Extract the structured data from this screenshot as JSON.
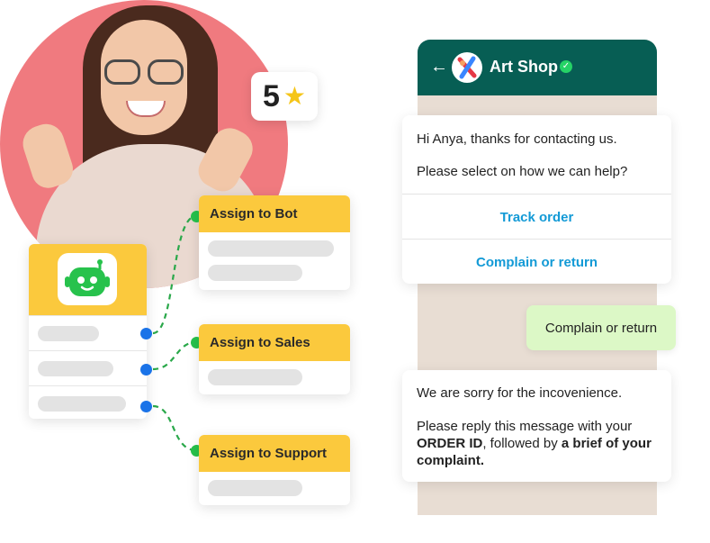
{
  "rating": {
    "value": "5",
    "icon": "star-icon"
  },
  "bot_card": {
    "icon": "robot-icon"
  },
  "assign": [
    {
      "label": "Assign to Bot"
    },
    {
      "label": "Assign to  Sales"
    },
    {
      "label": "Assign to Support"
    }
  ],
  "chat": {
    "title": "Art Shop",
    "back_icon": "back-arrow-icon",
    "verified_icon": "verified-badge-icon",
    "greeting_line1": "Hi Anya, thanks for contacting us.",
    "greeting_line2": "Please select on how we can help?",
    "options": [
      "Track order",
      "Complain or return"
    ],
    "user_reply": "Complain or return",
    "reply_line1": "We are sorry for the incovenience.",
    "reply_line2_a": "Please reply this message with your",
    "reply_line3_bold1": "ORDER ID",
    "reply_line3_mid": ", followed by ",
    "reply_line3_bold2": "a brief of your",
    "reply_line4_bold": "complaint."
  },
  "colors": {
    "brand_yellow": "#fbc93d",
    "chat_header": "#075e54",
    "link_blue": "#139ad6",
    "coral": "#f07a7f",
    "outgoing_bubble": "#dcf8c6"
  }
}
